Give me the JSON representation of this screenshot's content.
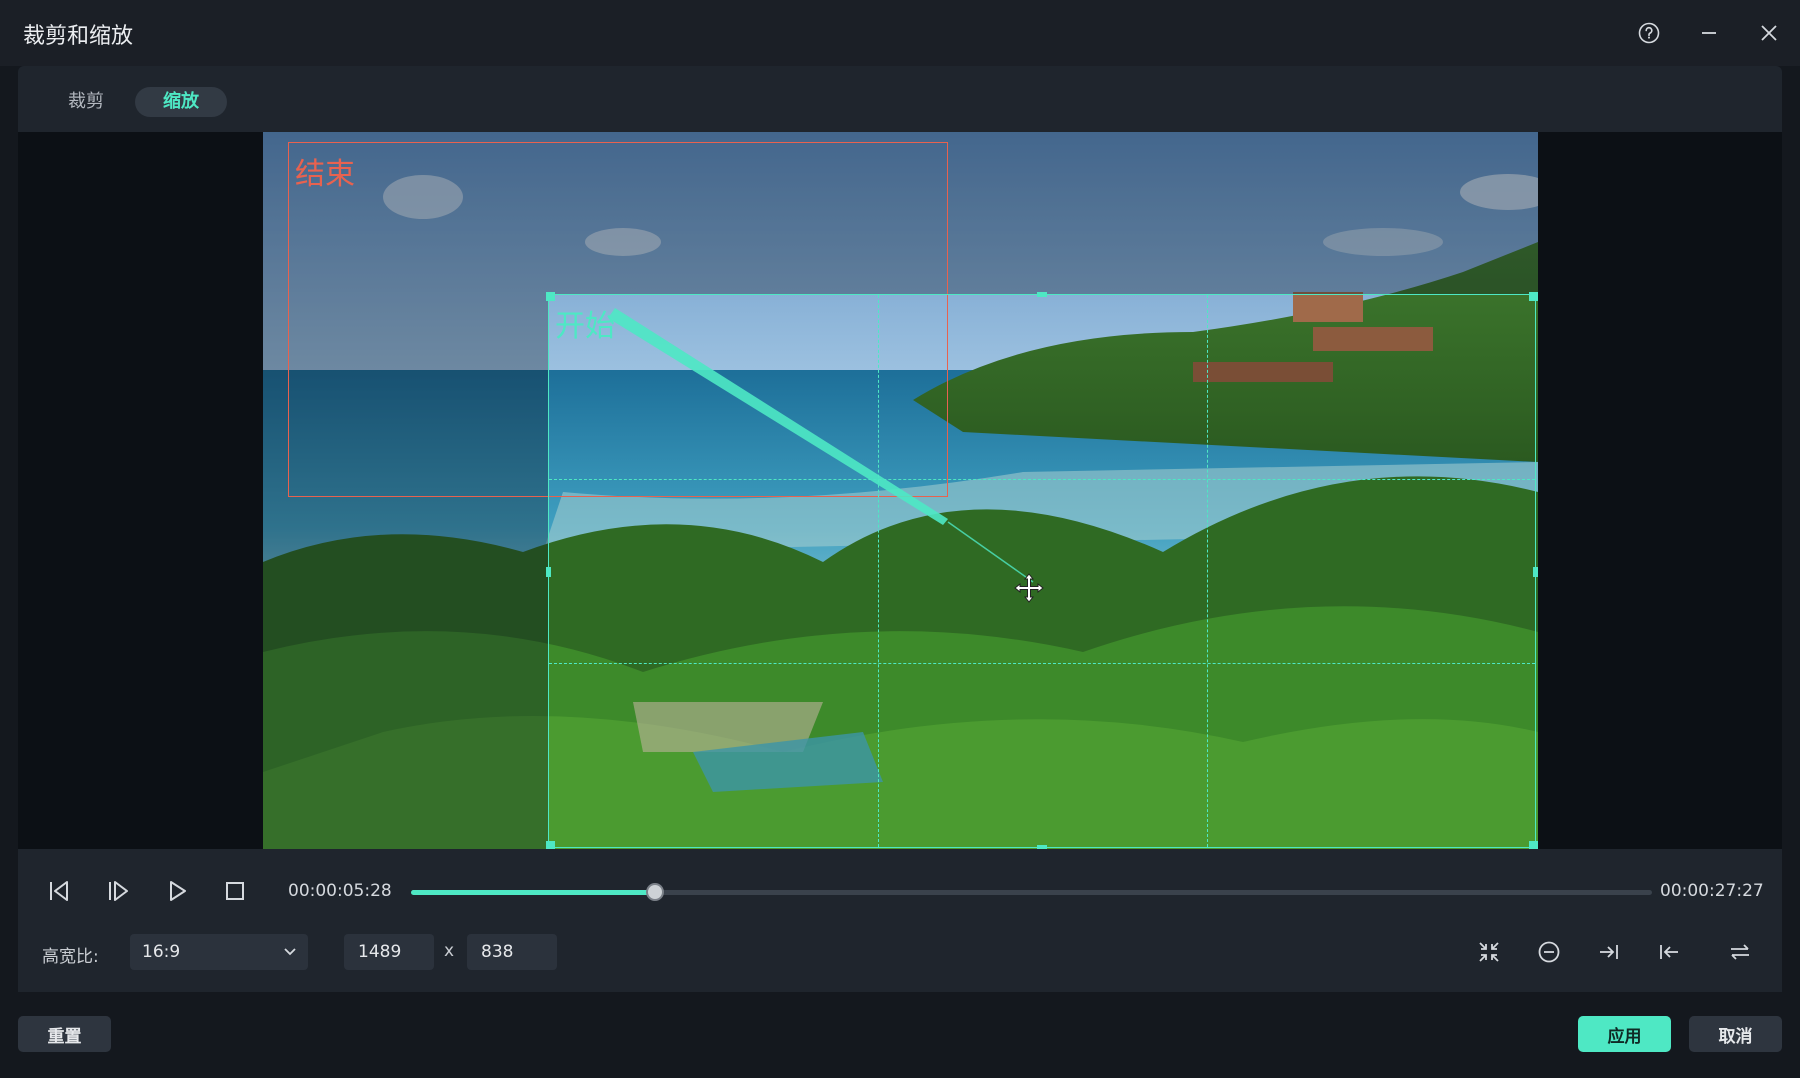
{
  "window": {
    "title": "裁剪和缩放"
  },
  "tabs": [
    {
      "label": "裁剪",
      "active": false
    },
    {
      "label": "缩放",
      "active": true
    }
  ],
  "overlay": {
    "end_label": "结束",
    "start_label": "开始"
  },
  "playback": {
    "current_time": "00:00:05:28",
    "total_time": "00:00:27:27",
    "progress": 0.1968
  },
  "aspect": {
    "label": "高宽比:",
    "value": "16:9"
  },
  "size": {
    "width": "1489",
    "separator": "x",
    "height": "838"
  },
  "footer": {
    "reset": "重置",
    "apply": "应用",
    "cancel": "取消"
  },
  "colors": {
    "accent": "#4ee8c4",
    "end_box": "#e8624f",
    "bg": "#14181e"
  },
  "icons": [
    "help-icon",
    "minimize-icon",
    "close-icon",
    "prev-frame-icon",
    "next-frame-icon",
    "play-icon",
    "stop-icon",
    "chevron-down-icon",
    "fit-icon",
    "zoom-out-icon",
    "to-end-icon",
    "to-start-icon",
    "swap-icon",
    "move-cursor-icon"
  ]
}
